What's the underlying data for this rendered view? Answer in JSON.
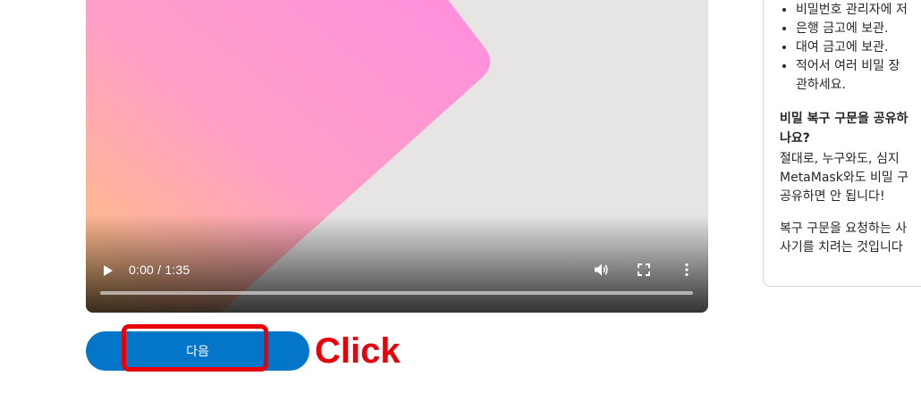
{
  "video": {
    "time": "0:00 / 1:35",
    "progress": 0
  },
  "next_button": {
    "label": "다음"
  },
  "annotation": {
    "label": "Click",
    "color": "#e8000b"
  },
  "panel": {
    "bullets": [
      "비밀번호 관리자에 저",
      "은행 금고에 보관.",
      "대여 금고에 보관.",
      "적어서 여러 비밀 장\n관하세요."
    ],
    "question": "비밀 복구 구문을 공유하\n나요?",
    "paragraph1": "절대로, 누구와도, 심지\nMetaMask와도 비밀 구\n공유하면 안 됩니다!",
    "paragraph2": "복구 구문을 요청하는 사\n사기를 치려는 것입니다"
  },
  "colors": {
    "primary": "#0376c9",
    "annotation": "#e8000b"
  }
}
